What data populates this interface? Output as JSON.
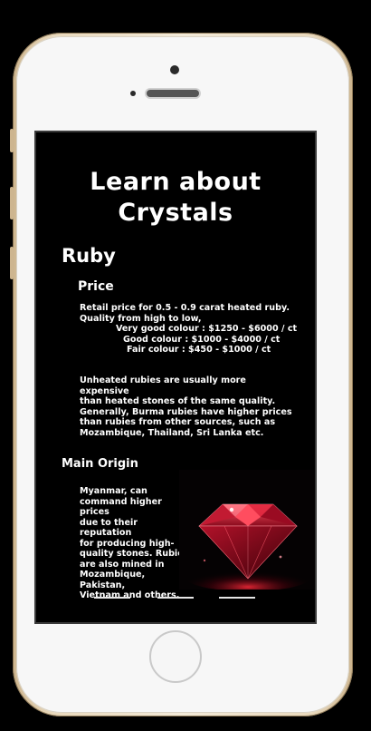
{
  "screen": {
    "title_line1": "Learn about",
    "title_line2": "Crystals",
    "gem_name": "Ruby",
    "price": {
      "heading": "Price",
      "line1": "Retail price  for 0.5 - 0.9 carat heated ruby.",
      "line2": "Quality from high to low,",
      "grade1": "Very good colour : $1250 - $6000 / ct",
      "grade2": "Good colour : $1000 - $4000 / ct",
      "grade3": "Fair colour : $450 - $1000 / ct",
      "unheated_lines": [
        "Unheated rubies are usually more expensive",
        "than heated stones of the same quality.",
        "Generally, Burma rubies have higher prices",
        "than rubies from other sources, such as",
        "Mozambique, Thailand, Sri Lanka etc."
      ]
    },
    "origin": {
      "heading": "Main Origin",
      "lines": [
        "Myanmar, can",
        "command higher prices",
        "due to their reputation",
        "for producing high-",
        "quality stones. Rubies",
        "are also mined in",
        "Mozambique, Pakistan,",
        "Vietnam and others."
      ]
    },
    "image_icon": "ruby-gem-icon"
  },
  "colors": {
    "phone_gold": "#cdb58f",
    "screen_bg": "#000000",
    "text": "#ffffff",
    "ruby_red": "#c8102e"
  }
}
